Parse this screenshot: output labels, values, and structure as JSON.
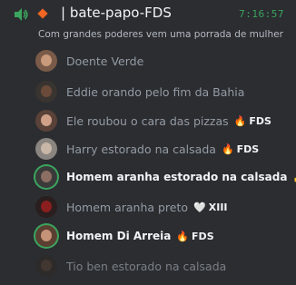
{
  "header": {
    "channel_prefix": "| bate-papo-FDS",
    "clock": "7:16:57",
    "topic": "Com grandes poderes vem uma porrada de mulher"
  },
  "colors": {
    "background": "#2b2d31",
    "accent_green": "#3ba55d",
    "accent_orange": "#f26522"
  },
  "members": [
    {
      "name": "Doente Verde",
      "bold": false,
      "badge_emoji": "",
      "badge_text": "",
      "avatar_color": "#7a5a48",
      "face_color": "#c99a7b",
      "ring": false
    },
    {
      "name": "Eddie orando pelo fim da Bahia",
      "bold": false,
      "badge_emoji": "",
      "badge_text": "",
      "avatar_color": "#3a3430",
      "face_color": "#6b4a3a",
      "ring": false
    },
    {
      "name": "Ele roubou o cara das pizzas",
      "bold": false,
      "badge_emoji": "🔥",
      "badge_text": "FDS",
      "avatar_color": "#5a4238",
      "face_color": "#d0a088",
      "ring": false
    },
    {
      "name": "Harry estorado na calsada",
      "bold": false,
      "badge_emoji": "🔥",
      "badge_text": "FDS",
      "avatar_color": "#8a8580",
      "face_color": "#c8b6a6",
      "ring": false
    },
    {
      "name": "Homem aranha estorado na calsada",
      "bold": true,
      "badge_emoji": "👍",
      "badge_text": "",
      "avatar_color": "#3a3a3a",
      "face_color": "#8d6e63",
      "ring": true
    },
    {
      "name": "Homem aranha preto",
      "bold": false,
      "badge_emoji": "🤍",
      "badge_text": "XIII",
      "avatar_color": "#2a1e1e",
      "face_color": "#8b1e1e",
      "ring": false
    },
    {
      "name": "Homem Di Arreia",
      "bold": true,
      "badge_emoji": "🔥",
      "badge_text": "FDS",
      "avatar_color": "#5b4032",
      "face_color": "#c49378",
      "ring": true
    },
    {
      "name": "Tio ben estorado na calsada",
      "bold": false,
      "badge_emoji": "",
      "badge_text": "",
      "avatar_color": "#2e2a28",
      "face_color": "#4a3a32",
      "ring": false
    }
  ]
}
